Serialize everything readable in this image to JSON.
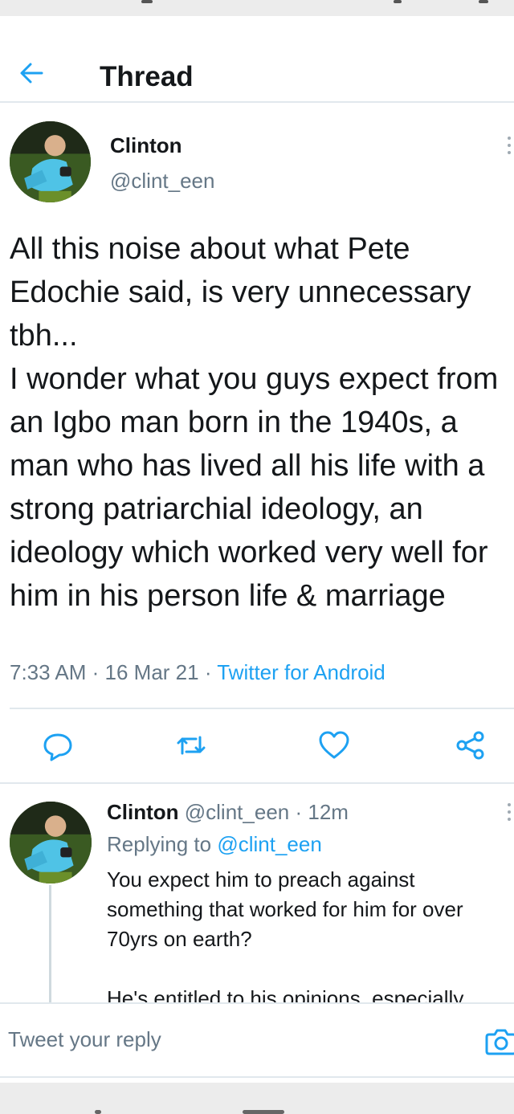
{
  "header": {
    "title": "Thread"
  },
  "main_tweet": {
    "author_name": "Clinton",
    "author_handle": "@clint_een",
    "text": "All this noise about what Pete Edochie said, is very unnecessary tbh...\nI wonder what you guys expect from an Igbo man born in the 1940s, a man who has lived all his life with a strong patriarchial ideology, an ideology which worked very well for him in his person life & marriage",
    "time": "7:33 AM",
    "date": "16 Mar 21",
    "source": "Twitter for Android",
    "separator": " · "
  },
  "reply_tweet": {
    "author_name": "Clinton",
    "author_handle": "@clint_een",
    "age": "12m",
    "replying_prefix": "Replying to ",
    "replying_to": "@clint_een",
    "text": "You expect him to preach against something that worked for him for over 70yrs on earth?\n\nHe's entitled to his opinions, especially"
  },
  "composer": {
    "placeholder": "Tweet your reply"
  },
  "colors": {
    "accent": "#1da1f2",
    "muted": "#657786",
    "text": "#14171a",
    "divider": "#e1e8ed"
  },
  "icons": [
    "back-arrow-icon",
    "more-options-icon",
    "reply-icon",
    "retweet-icon",
    "like-icon",
    "share-icon",
    "camera-icon"
  ]
}
